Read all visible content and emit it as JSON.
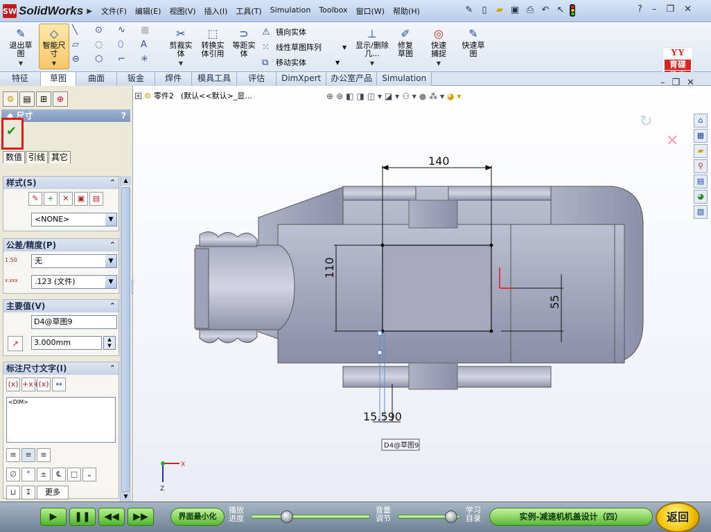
{
  "app": {
    "logo": "SolidWorks",
    "logo_badge": "SW"
  },
  "menus": [
    "文件(F)",
    "编辑(E)",
    "视图(V)",
    "插入(I)",
    "工具(T)",
    "Simulation",
    "Toolbox",
    "窗口(W)",
    "帮助(H)"
  ],
  "ribbon": {
    "exit_sketch": "退出草图",
    "smart_dim": "智能尺寸",
    "trim": "剪裁实体",
    "convert": "转换实体引用",
    "offset": "等距实体",
    "mirror": "镜向实体",
    "linear_pattern": "线性草图阵列",
    "move": "移动实体",
    "show_delete": "显示/删除几...",
    "repair": "修复草图",
    "quick_snap": "快速捕捉",
    "rapid_sketch": "快速草图"
  },
  "brand": {
    "top": "YY",
    "line1": "育碟",
    "line2": "教育"
  },
  "tabs": [
    "特征",
    "草图",
    "曲面",
    "钣金",
    "焊件",
    "模具工具",
    "评估",
    "DimXpert",
    "办公室产品",
    "Simulation"
  ],
  "active_tab": "草图",
  "panel": {
    "title": "尺寸",
    "help": "?",
    "subtabs": [
      "数值",
      "引线",
      "其它"
    ],
    "style": {
      "title": "样式(S)",
      "value": "<NONE>"
    },
    "tolerance": {
      "title": "公差/精度(P)",
      "tol_value": "无",
      "precision_value": ".123 (文件)",
      "tol_icon": "1.50",
      "prec_icon": "x.xxx"
    },
    "primary": {
      "title": "主要值(V)",
      "name": "D4@草图9",
      "value": "3.000mm"
    },
    "dimtext": {
      "title": "标注尺寸文字(I)",
      "text": "<DIM>"
    },
    "more": "更多(M)..."
  },
  "graphics": {
    "tree_label": "零件2",
    "config": "(默认<<默认>_显...",
    "dims": {
      "d140": "140",
      "d110": "110",
      "d55": "55",
      "d15": "15.590"
    },
    "tag": "D4@草图9",
    "triad": {
      "x": "X",
      "z": "Z"
    }
  },
  "player": {
    "minimize": "界面最小化",
    "play_progress": [
      "播放",
      "进度"
    ],
    "volume": [
      "音量",
      "调节"
    ],
    "study_toc": [
      "学习",
      "目录"
    ],
    "lesson": "实例-减速机机盖设计（四）",
    "back": "返回",
    "progress": 0.3,
    "volume_level": 0.85
  },
  "colors": {
    "accent": "#f8c76a",
    "ok": "#1a9b1a",
    "highlight": "#e01818"
  }
}
